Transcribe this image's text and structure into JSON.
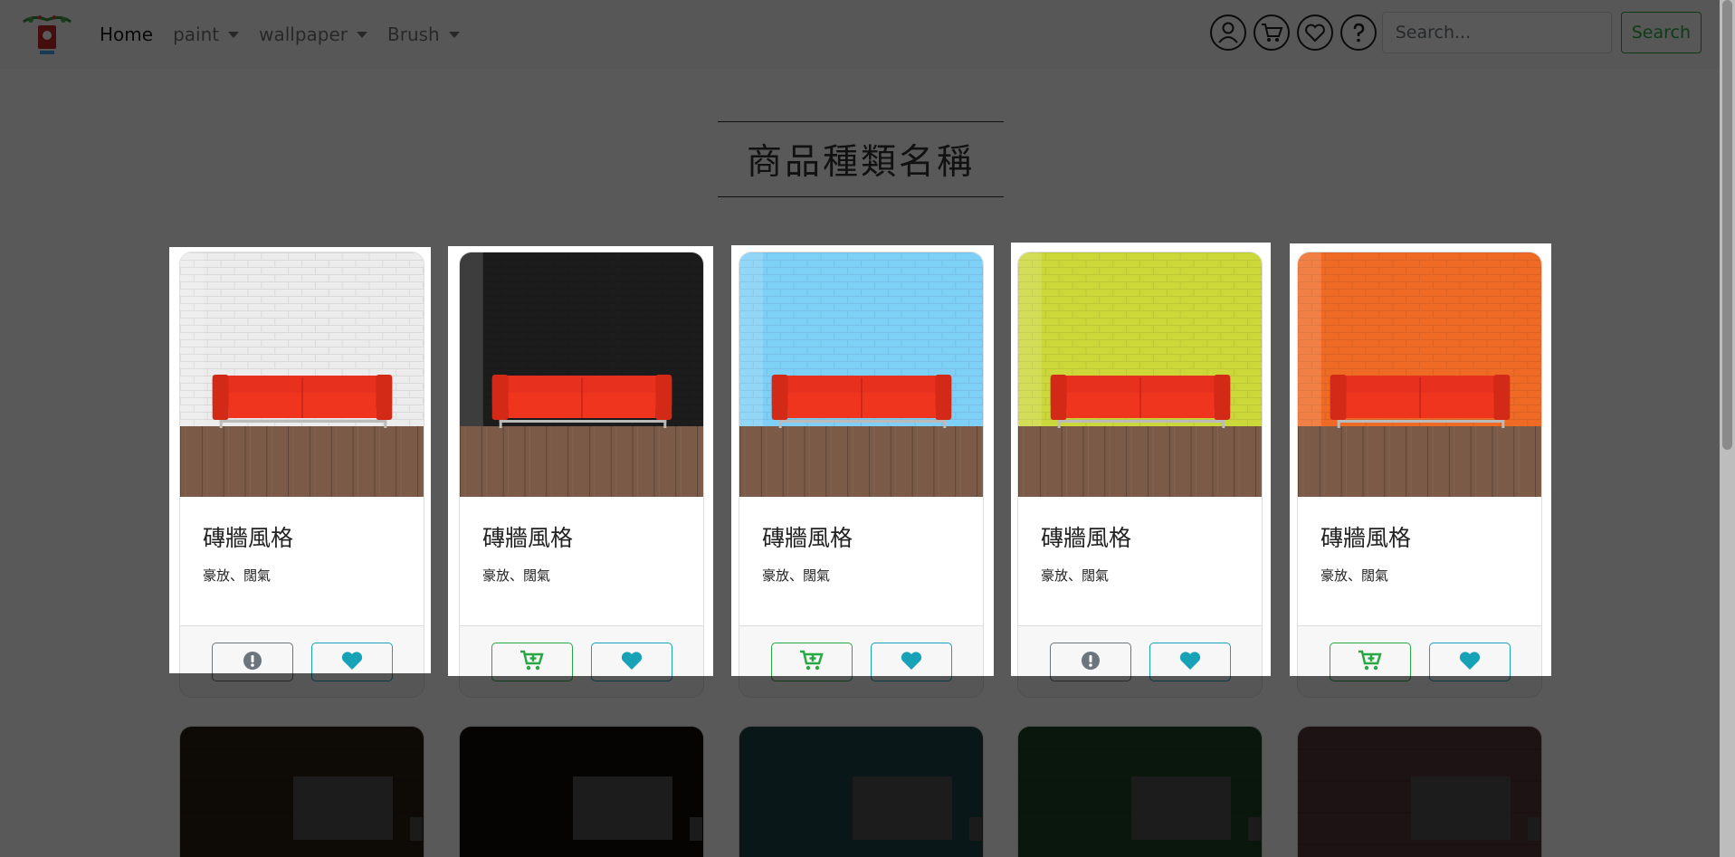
{
  "nav": {
    "items": [
      {
        "label": "Home",
        "active": true,
        "dropdown": false
      },
      {
        "label": "paint",
        "active": false,
        "dropdown": true
      },
      {
        "label": "wallpaper",
        "active": false,
        "dropdown": true
      },
      {
        "label": "Brush",
        "active": false,
        "dropdown": true
      }
    ],
    "icons": [
      "user-icon",
      "cart-icon",
      "heart-icon",
      "help-icon"
    ],
    "search_placeholder": "Search...",
    "search_button": "Search"
  },
  "section": {
    "title": "商品種類名稱"
  },
  "products": [
    {
      "name": "磚牆風格",
      "desc": "豪放、闊氣",
      "wall_color": "#ececec",
      "primary_action": "info",
      "primary_icon": "exclamation-icon"
    },
    {
      "name": "磚牆風格",
      "desc": "豪放、闊氣",
      "wall_color": "#1c1c1c",
      "primary_action": "cart",
      "primary_icon": "cart-plus-icon"
    },
    {
      "name": "磚牆風格",
      "desc": "豪放、闊氣",
      "wall_color": "#7fd0f7",
      "primary_action": "cart",
      "primary_icon": "cart-plus-icon"
    },
    {
      "name": "磚牆風格",
      "desc": "豪放、闊氣",
      "wall_color": "#ccd83a",
      "primary_action": "info",
      "primary_icon": "exclamation-icon"
    },
    {
      "name": "磚牆風格",
      "desc": "豪放、闊氣",
      "wall_color": "#ee6a25",
      "primary_action": "cart",
      "primary_icon": "cart-plus-icon"
    }
  ],
  "second_row": [
    {
      "wall_color": "#7a5435"
    },
    {
      "wall_color": "#2d2520"
    },
    {
      "wall_color": "#55bfd2"
    },
    {
      "wall_color": "#4fbf6a"
    },
    {
      "wall_color": "#f09aa6"
    }
  ],
  "colors": {
    "success": "#28a745",
    "info": "#17a2b8",
    "secondary": "#6c757d",
    "sofa": "#e8301e"
  }
}
